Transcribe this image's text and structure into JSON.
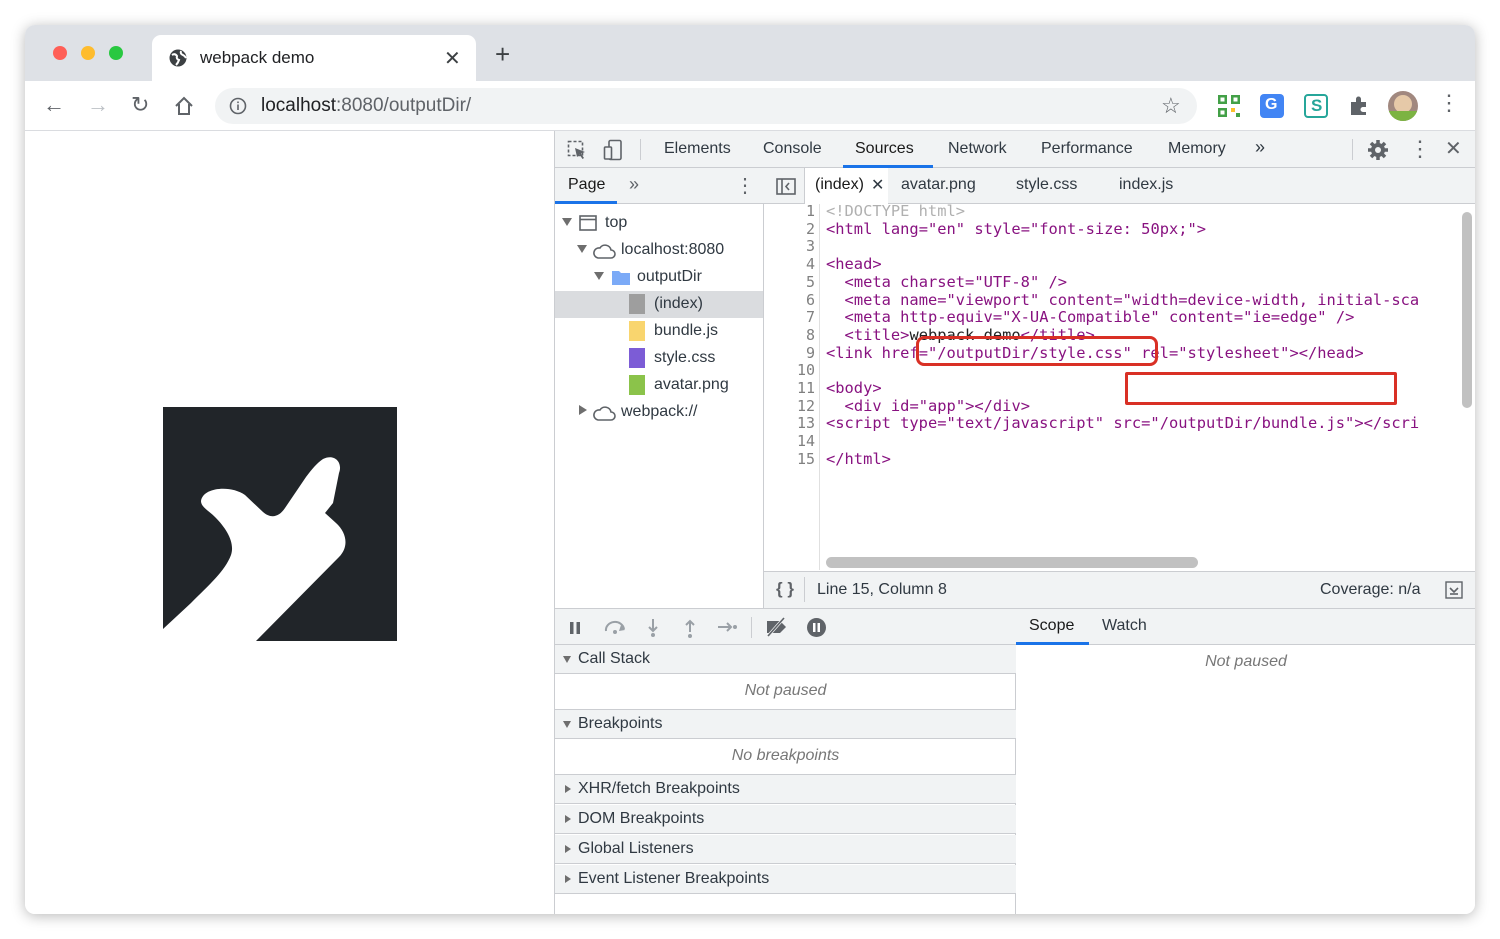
{
  "browser": {
    "tab_title": "webpack demo",
    "url_host": "localhost",
    "url_rest": ":8080/outputDir/"
  },
  "devtools": {
    "tabs": [
      "Elements",
      "Console",
      "Sources",
      "Network",
      "Performance",
      "Memory"
    ],
    "active_tab": "Sources",
    "navigator": {
      "header": "Page",
      "tree": [
        {
          "label": "top",
          "level": 0
        },
        {
          "label": "localhost:8080",
          "level": 1
        },
        {
          "label": "outputDir",
          "level": 2
        },
        {
          "label": "(index)",
          "level": 3,
          "selected": true
        },
        {
          "label": "bundle.js",
          "level": 3
        },
        {
          "label": "style.css",
          "level": 3
        },
        {
          "label": "avatar.png",
          "level": 3
        },
        {
          "label": "webpack://",
          "level": 1
        }
      ]
    },
    "editor_tabs": [
      "(index)",
      "avatar.png",
      "style.css",
      "index.js"
    ],
    "code_lines": [
      "<!DOCTYPE html>",
      "<html lang=\"en\" style=\"font-size: 50px;\">",
      "",
      "<head>",
      "  <meta charset=\"UTF-8\" />",
      "  <meta name=\"viewport\" content=\"width=device-width, initial-sca",
      "  <meta http-equiv=\"X-UA-Compatible\" content=\"ie=edge\" />",
      "  <title>webpack demo</title>",
      "<link href=\"/outputDir/style.css\" rel=\"stylesheet\"></head>",
      "",
      "<body>",
      "  <div id=\"app\"></div>",
      "<script type=\"text/javascript\" src=\"/outputDir/bundle.js\"></scri",
      "",
      "</html>"
    ],
    "status": {
      "position": "Line 15, Column 8",
      "coverage": "Coverage: n/a"
    },
    "debugger": {
      "sections": [
        {
          "label": "Call Stack",
          "expanded": true,
          "body": "Not paused"
        },
        {
          "label": "Breakpoints",
          "expanded": true,
          "body": "No breakpoints"
        },
        {
          "label": "XHR/fetch Breakpoints",
          "expanded": false
        },
        {
          "label": "DOM Breakpoints",
          "expanded": false
        },
        {
          "label": "Global Listeners",
          "expanded": false
        },
        {
          "label": "Event Listener Breakpoints",
          "expanded": false
        }
      ]
    },
    "scope": {
      "tabs": [
        "Scope",
        "Watch"
      ],
      "body": "Not paused"
    }
  },
  "colors": {
    "accent": "#1a73e8",
    "highlight_box": "#d93025",
    "page_logo": "#212529"
  }
}
